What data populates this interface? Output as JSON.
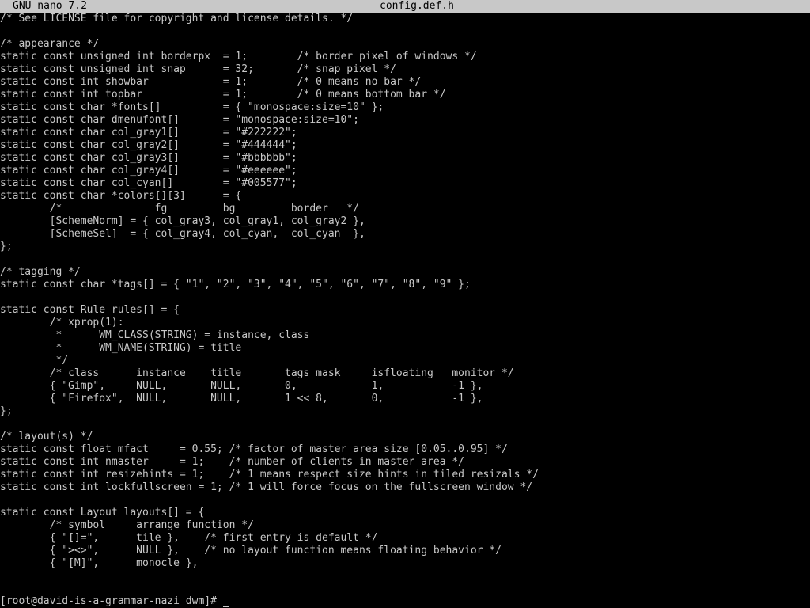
{
  "titlebar": {
    "app": "GNU nano 7.2",
    "file": "config.def.h"
  },
  "lines": [
    "/* See LICENSE file for copyright and license details. */",
    "",
    "/* appearance */",
    "static const unsigned int borderpx  = 1;        /* border pixel of windows */",
    "static const unsigned int snap      = 32;       /* snap pixel */",
    "static const int showbar            = 1;        /* 0 means no bar */",
    "static const int topbar             = 1;        /* 0 means bottom bar */",
    "static const char *fonts[]          = { \"monospace:size=10\" };",
    "static const char dmenufont[]       = \"monospace:size=10\";",
    "static const char col_gray1[]       = \"#222222\";",
    "static const char col_gray2[]       = \"#444444\";",
    "static const char col_gray3[]       = \"#bbbbbb\";",
    "static const char col_gray4[]       = \"#eeeeee\";",
    "static const char col_cyan[]        = \"#005577\";",
    "static const char *colors[][3]      = {",
    "        /*               fg         bg         border   */",
    "        [SchemeNorm] = { col_gray3, col_gray1, col_gray2 },",
    "        [SchemeSel]  = { col_gray4, col_cyan,  col_cyan  },",
    "};",
    "",
    "/* tagging */",
    "static const char *tags[] = { \"1\", \"2\", \"3\", \"4\", \"5\", \"6\", \"7\", \"8\", \"9\" };",
    "",
    "static const Rule rules[] = {",
    "        /* xprop(1):",
    "         *      WM_CLASS(STRING) = instance, class",
    "         *      WM_NAME(STRING) = title",
    "         */",
    "        /* class      instance    title       tags mask     isfloating   monitor */",
    "        { \"Gimp\",     NULL,       NULL,       0,            1,           -1 },",
    "        { \"Firefox\",  NULL,       NULL,       1 << 8,       0,           -1 },",
    "};",
    "",
    "/* layout(s) */",
    "static const float mfact     = 0.55; /* factor of master area size [0.05..0.95] */",
    "static const int nmaster     = 1;    /* number of clients in master area */",
    "static const int resizehints = 1;    /* 1 means respect size hints in tiled resizals */",
    "static const int lockfullscreen = 1; /* 1 will force focus on the fullscreen window */",
    "",
    "static const Layout layouts[] = {",
    "        /* symbol     arrange function */",
    "        { \"[]=\",      tile },    /* first entry is default */",
    "        { \"><>\",      NULL },    /* no layout function means floating behavior */",
    "        { \"[M]\",      monocle },",
    "",
    ""
  ],
  "prompt": "[root@david-is-a-grammar-nazi dwm]# "
}
